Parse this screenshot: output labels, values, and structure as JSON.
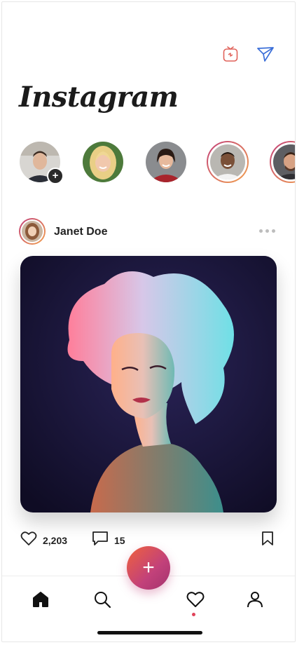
{
  "app": {
    "title": "Instagram"
  },
  "header": {
    "icons": [
      "igtv-icon",
      "send-icon"
    ]
  },
  "stories": [
    {
      "name": "my-story",
      "ring": false,
      "add": true,
      "add_label": "+"
    },
    {
      "name": "story-blonde-woman",
      "ring": false
    },
    {
      "name": "story-smiling-woman",
      "ring": false
    },
    {
      "name": "story-man-smiling",
      "ring": true
    },
    {
      "name": "story-man-beard",
      "ring": true
    }
  ],
  "post": {
    "author": "Janet Doe",
    "likes": "2,203",
    "comments": "15"
  },
  "fab": {
    "label": "+"
  },
  "tabs": [
    "home",
    "search",
    "activity",
    "profile"
  ],
  "colors": {
    "accent_start": "#f0623c",
    "accent_end": "#c2417a",
    "text": "#222222"
  }
}
